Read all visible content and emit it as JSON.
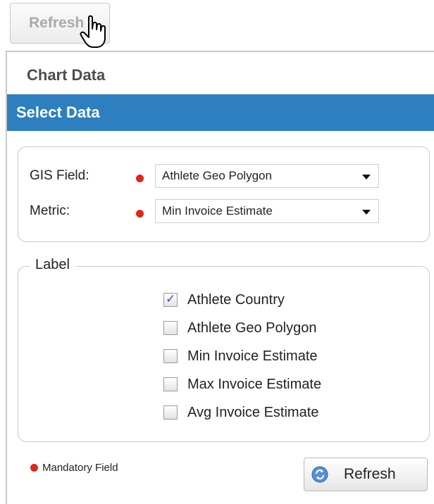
{
  "top_refresh": {
    "label": "Refresh"
  },
  "panel": {
    "title": "Chart Data",
    "section_header": "Select Data",
    "fields": [
      {
        "label": "GIS Field:",
        "value": "Athlete Geo Polygon"
      },
      {
        "label": "Metric:",
        "value": "Min Invoice Estimate"
      }
    ],
    "label_group": {
      "legend": "Label",
      "options": [
        {
          "label": "Athlete Country",
          "checked": true
        },
        {
          "label": "Athlete Geo Polygon",
          "checked": false
        },
        {
          "label": "Min Invoice Estimate",
          "checked": false
        },
        {
          "label": "Max Invoice Estimate",
          "checked": false
        },
        {
          "label": "Avg Invoice Estimate",
          "checked": false
        }
      ]
    },
    "mandatory_note": "Mandatory Field",
    "refresh_label": "Refresh"
  },
  "colors": {
    "accent": "#2d7fbf",
    "required": "#e0251b"
  },
  "icons": {
    "cursor": "hand-pointer-icon",
    "refresh": "refresh-icon",
    "required": "required-dot-icon"
  }
}
